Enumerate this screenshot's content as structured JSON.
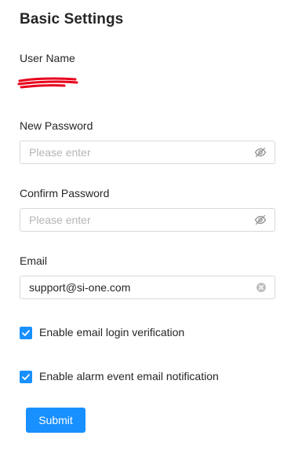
{
  "title": "Basic Settings",
  "user_name": {
    "label": "User Name"
  },
  "new_password": {
    "label": "New Password",
    "placeholder": "Please enter",
    "suffix_icon": "eye-invisible-icon"
  },
  "confirm_password": {
    "label": "Confirm Password",
    "placeholder": "Please enter",
    "suffix_icon": "eye-invisible-icon"
  },
  "email": {
    "label": "Email",
    "value": "support@si-one.com",
    "suffix_icon": "clear-icon"
  },
  "options": [
    {
      "label": "Enable email login verification",
      "checked": true
    },
    {
      "label": "Enable alarm event email notification",
      "checked": true
    }
  ],
  "submit_label": "Submit",
  "colors": {
    "primary": "#1890ff",
    "redaction": "#e8001c",
    "border": "#d9d9d9",
    "placeholder": "#b5b5b5"
  }
}
